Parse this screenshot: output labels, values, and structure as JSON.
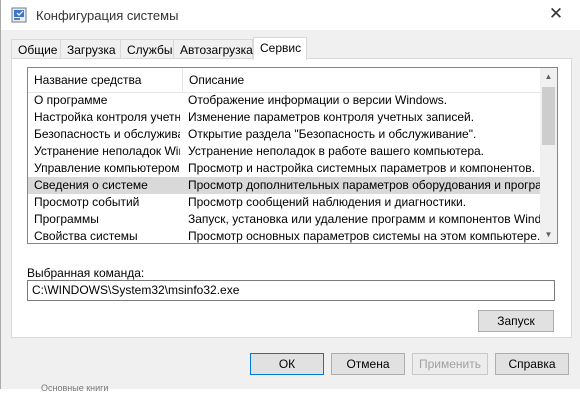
{
  "window": {
    "title": "Конфигурация системы",
    "close_glyph": "✕"
  },
  "tabs": [
    {
      "label": "Общие",
      "active": false
    },
    {
      "label": "Загрузка",
      "active": false
    },
    {
      "label": "Службы",
      "active": false
    },
    {
      "label": "Автозагрузка",
      "active": false
    },
    {
      "label": "Сервис",
      "active": true
    }
  ],
  "tools_list": {
    "columns": [
      "Название средства",
      "Описание"
    ],
    "rows": [
      {
        "name": "О программе",
        "description": "Отображение информации о версии Windows.",
        "selected": false
      },
      {
        "name": "Настройка контроля учетных записей",
        "description": "Изменение параметров контроля учетных записей.",
        "selected": false
      },
      {
        "name": "Безопасность и обслуживание",
        "description": "Открытие раздела \"Безопасность и обслуживание\".",
        "selected": false
      },
      {
        "name": "Устранение неполадок Windows",
        "description": "Устранение неполадок в работе вашего компьютера.",
        "selected": false
      },
      {
        "name": "Управление компьютером",
        "description": "Просмотр и настройка системных параметров и компонентов.",
        "selected": false
      },
      {
        "name": "Сведения о системе",
        "description": "Просмотр дополнительных параметров оборудования и программного обеспечения.",
        "selected": true
      },
      {
        "name": "Просмотр событий",
        "description": "Просмотр сообщений наблюдения и диагностики.",
        "selected": false
      },
      {
        "name": "Программы",
        "description": "Запуск, установка или удаление программ и компонентов Windows.",
        "selected": false
      },
      {
        "name": "Свойства системы",
        "description": "Просмотр основных параметров системы на этом компьютере.",
        "selected": false
      }
    ]
  },
  "selected_command": {
    "label": "Выбранная команда:",
    "value": "C:\\WINDOWS\\System32\\msinfo32.exe"
  },
  "buttons": {
    "launch": "Запуск",
    "ok": "ОК",
    "cancel": "Отмена",
    "apply": "Применить",
    "help": "Справка"
  },
  "scrollbar": {
    "up_glyph": "▲",
    "down_glyph": "▼"
  },
  "background_text": "Основные книги"
}
